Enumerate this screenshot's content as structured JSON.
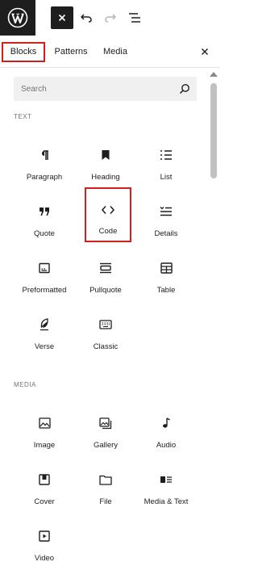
{
  "toolbar": {
    "logo_icon": "wordpress-logo-icon",
    "close_icon": "close-icon",
    "undo_icon": "undo-icon",
    "redo_icon": "redo-icon",
    "outline_icon": "document-overview-icon"
  },
  "tabs": [
    {
      "label": "Blocks",
      "selected": true
    },
    {
      "label": "Patterns",
      "selected": false
    },
    {
      "label": "Media",
      "selected": false
    }
  ],
  "search": {
    "placeholder": "Search",
    "value": ""
  },
  "sections": {
    "text": {
      "heading": "TEXT",
      "items": [
        {
          "label": "Paragraph",
          "icon": "paragraph-icon"
        },
        {
          "label": "Heading",
          "icon": "heading-bookmark-icon"
        },
        {
          "label": "List",
          "icon": "list-icon"
        },
        {
          "label": "Quote",
          "icon": "quote-icon"
        },
        {
          "label": "Code",
          "icon": "code-icon",
          "highlighted": true
        },
        {
          "label": "Details",
          "icon": "details-icon"
        },
        {
          "label": "Preformatted",
          "icon": "preformatted-icon"
        },
        {
          "label": "Pullquote",
          "icon": "pullquote-icon"
        },
        {
          "label": "Table",
          "icon": "table-icon"
        },
        {
          "label": "Verse",
          "icon": "verse-feather-icon"
        },
        {
          "label": "Classic",
          "icon": "keyboard-icon"
        }
      ]
    },
    "media": {
      "heading": "MEDIA",
      "items": [
        {
          "label": "Image",
          "icon": "image-icon"
        },
        {
          "label": "Gallery",
          "icon": "gallery-icon"
        },
        {
          "label": "Audio",
          "icon": "audio-note-icon"
        },
        {
          "label": "Cover",
          "icon": "cover-icon"
        },
        {
          "label": "File",
          "icon": "file-folder-icon"
        },
        {
          "label": "Media & Text",
          "icon": "media-text-icon"
        },
        {
          "label": "Video",
          "icon": "video-icon"
        }
      ]
    }
  },
  "colors": {
    "highlight_border": "#d11f1f",
    "dark": "#1e1e1e",
    "muted": "#757575"
  }
}
